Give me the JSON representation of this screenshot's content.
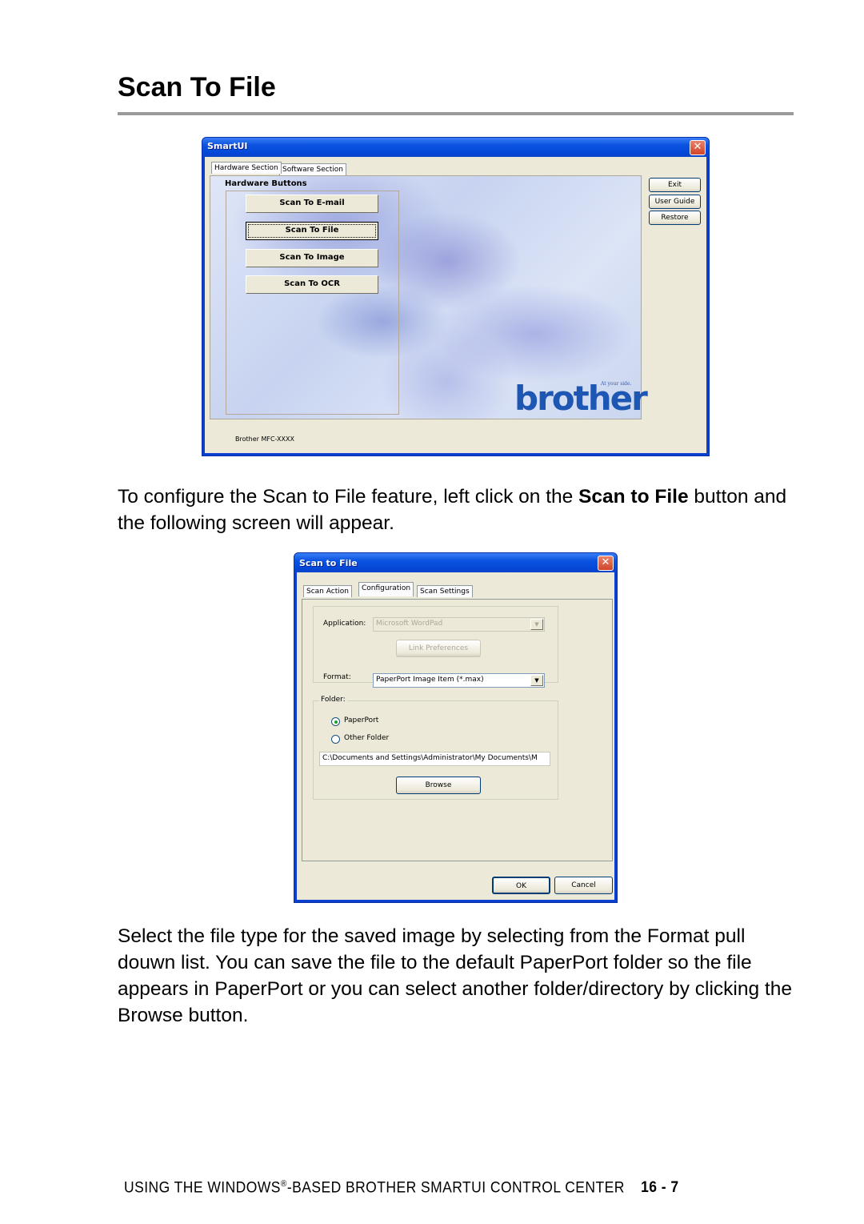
{
  "page": {
    "heading": "Scan To File",
    "paragraph1_pre": "To configure the Scan to File feature, left click on the ",
    "paragraph1_bold": "Scan to File",
    "paragraph1_post": " button and the following screen will appear.",
    "paragraph2": "Select the file type for the saved image by selecting from the Format pull douwn list. You can save the file to the default PaperPort folder so the file appears in PaperPort or you can select another folder/directory by clicking the Browse button.",
    "footer_pre": "USING THE WINDOWS",
    "footer_reg": "®",
    "footer_post": "-BASED BROTHER SMARTUI CONTROL CENTER",
    "page_number": "16 - 7"
  },
  "smartui": {
    "title": "SmartUI",
    "close_glyph": "✕",
    "tabs": [
      {
        "label": "Hardware Section",
        "active": true
      },
      {
        "label": "Software Section",
        "active": false
      }
    ],
    "group_label": "Hardware Buttons",
    "buttons": [
      "Scan To E-mail",
      "Scan To File",
      "Scan To Image",
      "Scan To OCR"
    ],
    "side_buttons": [
      "Exit",
      "User Guide",
      "Restore"
    ],
    "logo_tagline": "At your side.",
    "logo_text": "brother",
    "model": "Brother MFC-XXXX"
  },
  "scan_to_file": {
    "title": "Scan to File",
    "close_glyph": "✕",
    "tabs": [
      {
        "label": "Scan Action",
        "active": false
      },
      {
        "label": "Configuration",
        "active": true
      },
      {
        "label": "Scan Settings",
        "active": false
      }
    ],
    "application_label": "Application:",
    "application_value": "Microsoft WordPad",
    "link_preferences": "Link Preferences",
    "format_label": "Format:",
    "format_value": "PaperPort Image Item (*.max)",
    "folder_label": "Folder:",
    "radio_paperport": "PaperPort",
    "radio_other": "Other Folder",
    "selected_radio": "PaperPort",
    "path_value": "C:\\Documents and Settings\\Administrator\\My Documents\\M",
    "browse": "Browse",
    "ok": "OK",
    "cancel": "Cancel",
    "dropdown_glyph": "▼"
  }
}
